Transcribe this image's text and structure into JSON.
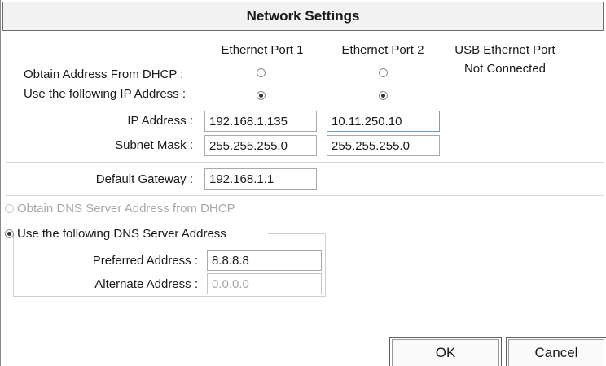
{
  "window": {
    "title": "Network Settings"
  },
  "columns": {
    "port1": "Ethernet Port 1",
    "port2": "Ethernet Port 2",
    "usb": "USB Ethernet Port",
    "usb_status": "Not Connected"
  },
  "ip_mode": {
    "dhcp_label": "Obtain Address From DHCP :",
    "static_label": "Use the following IP Address :",
    "port1_selected": "static",
    "port2_selected": "static"
  },
  "ip": {
    "ip_label": "IP Address :",
    "mask_label": "Subnet Mask :",
    "port1_ip": "192.168.1.135",
    "port2_ip": "10.11.250.10",
    "port1_mask": "255.255.255.0",
    "port2_mask": "255.255.255.0"
  },
  "gateway": {
    "label": "Default Gateway :",
    "value": "192.168.1.1"
  },
  "dns": {
    "dhcp_option": "Obtain DNS Server Address from DHCP",
    "manual_option": "Use the following DNS Server Address",
    "selected": "manual",
    "preferred_label": "Preferred Address :",
    "preferred_value": "8.8.8.8",
    "alternate_label": "Alternate Address :",
    "alternate_value": "0.0.0.0"
  },
  "buttons": {
    "ok": "OK",
    "cancel": "Cancel"
  }
}
